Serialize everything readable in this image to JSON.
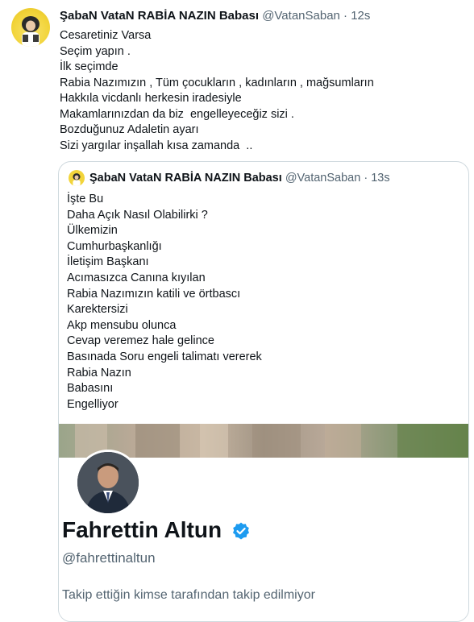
{
  "tweet": {
    "author_name": "ŞabaN VataN RABİA NAZIN Babası",
    "handle": "@VatanSaban",
    "separator": "·",
    "time": "12s",
    "lines": [
      "Cesaretiniz Varsa",
      "Seçim yapın .",
      "İlk seçimde",
      "Rabia Nazımızın , Tüm çocukların , kadınların , mağsumların",
      "Hakkıla vicdanlı herkesin iradesiyle",
      "Makamlarınızdan da biz  engelleyeceğiz sizi .",
      "Bozduğunuz Adaletin ayarı",
      "Sizi yargılar inşallah kısa zamanda  .."
    ]
  },
  "quote": {
    "author_name": "ŞabaN VataN RABİA NAZIN Babası",
    "handle": "@VatanSaban",
    "separator": "·",
    "time": "13s",
    "lines": [
      "İşte Bu",
      "Daha Açık Nasıl Olabilirki ?",
      "Ülkemizin",
      "Cumhurbaşkanlığı",
      "İletişim Başkanı",
      "Acımasızca Canına kıyılan",
      "Rabia Nazımızın katili ve örtbascı",
      "Karektersizi",
      "Akp mensubu olunca",
      "Cevap veremez hale gelince",
      "Basınada Soru engeli talimatı vererek",
      "Rabia Nazın",
      "Babasını",
      "Engelliyor"
    ],
    "profile": {
      "name": "Fahrettin Altun",
      "handle": "@fahrettinaltun",
      "follow_note": "Takip ettiğin kimse tarafından takip edilmiyor"
    }
  },
  "colors": {
    "text": "#0f1419",
    "secondary": "#536471",
    "border": "#cfd9de",
    "verified": "#1d9bf0"
  }
}
